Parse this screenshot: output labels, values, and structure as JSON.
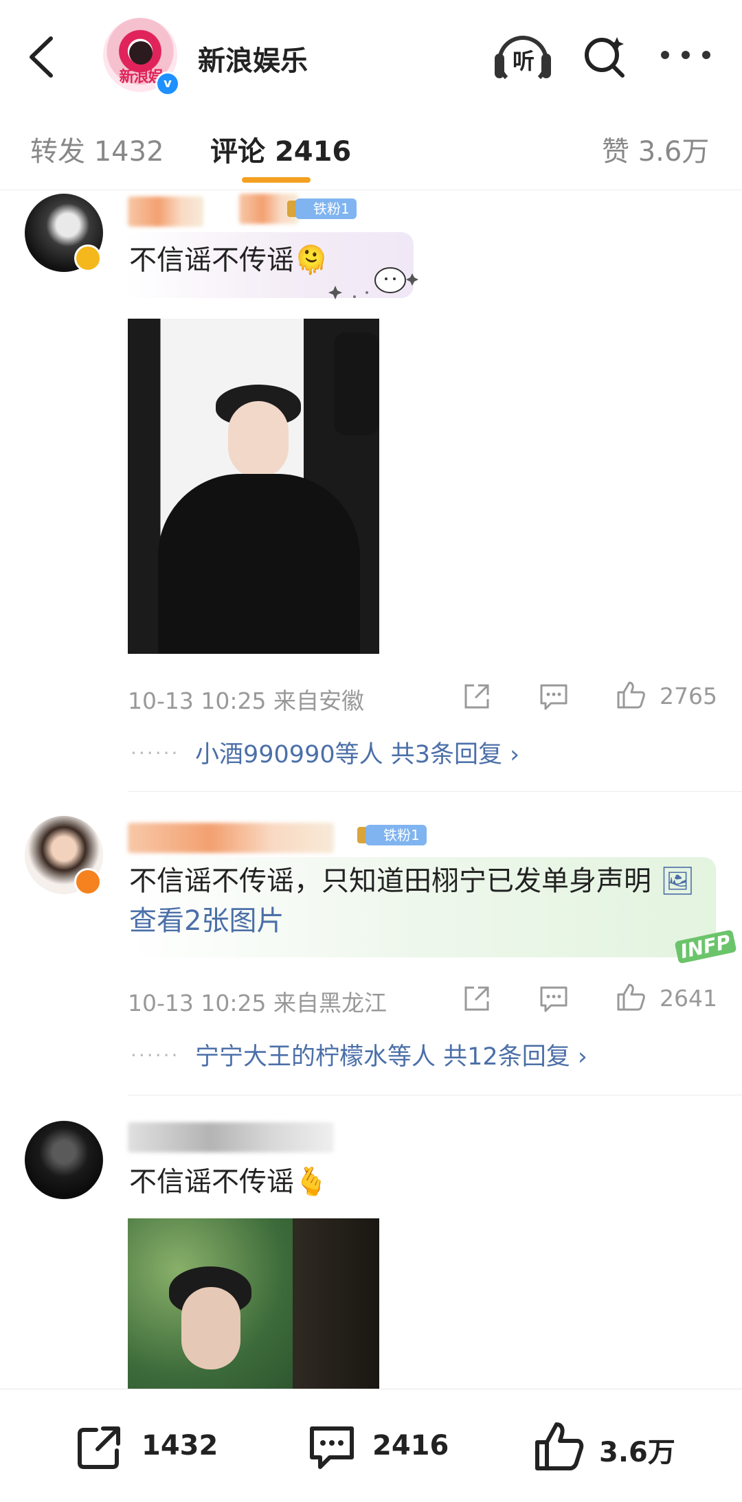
{
  "header": {
    "account_name": "新浪娱乐",
    "verified_mark": "v",
    "avatar_text": "新浪娱",
    "listen_label": "听"
  },
  "tabs": {
    "repost": {
      "label": "转发",
      "count": "1432"
    },
    "comment": {
      "label": "评论",
      "count": "2416"
    },
    "like": {
      "label": "赞",
      "count": "3.6万"
    }
  },
  "comments": [
    {
      "fan_badge": "铁粉1",
      "text": "不信谣不传谣🫠",
      "time": "10-13 10:25",
      "location": "来自安徽",
      "likes": "2765",
      "reply_prefix": "小酒990990等人",
      "reply_count": "共3条回复",
      "has_image": true
    },
    {
      "fan_badge": "铁粉1",
      "text": "不信谣不传谣，只知道田栩宁已发单身声明",
      "link_text": "查看2张图片",
      "time": "10-13 10:25",
      "location": "来自黑龙江",
      "likes": "2641",
      "reply_prefix": "宁宁大王的柠檬水等人",
      "reply_count": "共12条回复",
      "decoration_text": "INFP"
    },
    {
      "text": "不信谣不传谣🫰",
      "has_image": true
    }
  ],
  "bottom_bar": {
    "repost_count": "1432",
    "comment_count": "2416",
    "like_count": "3.6万"
  },
  "colors": {
    "accent": "#f4a020",
    "link": "#4b6fa8",
    "fan_badge": "#7fb4f0",
    "verified": "#1e90ff"
  },
  "icons": [
    "back-icon",
    "listen-icon",
    "search-icon",
    "more-icon",
    "share-icon",
    "comment-icon",
    "like-icon",
    "verified-icon"
  ]
}
